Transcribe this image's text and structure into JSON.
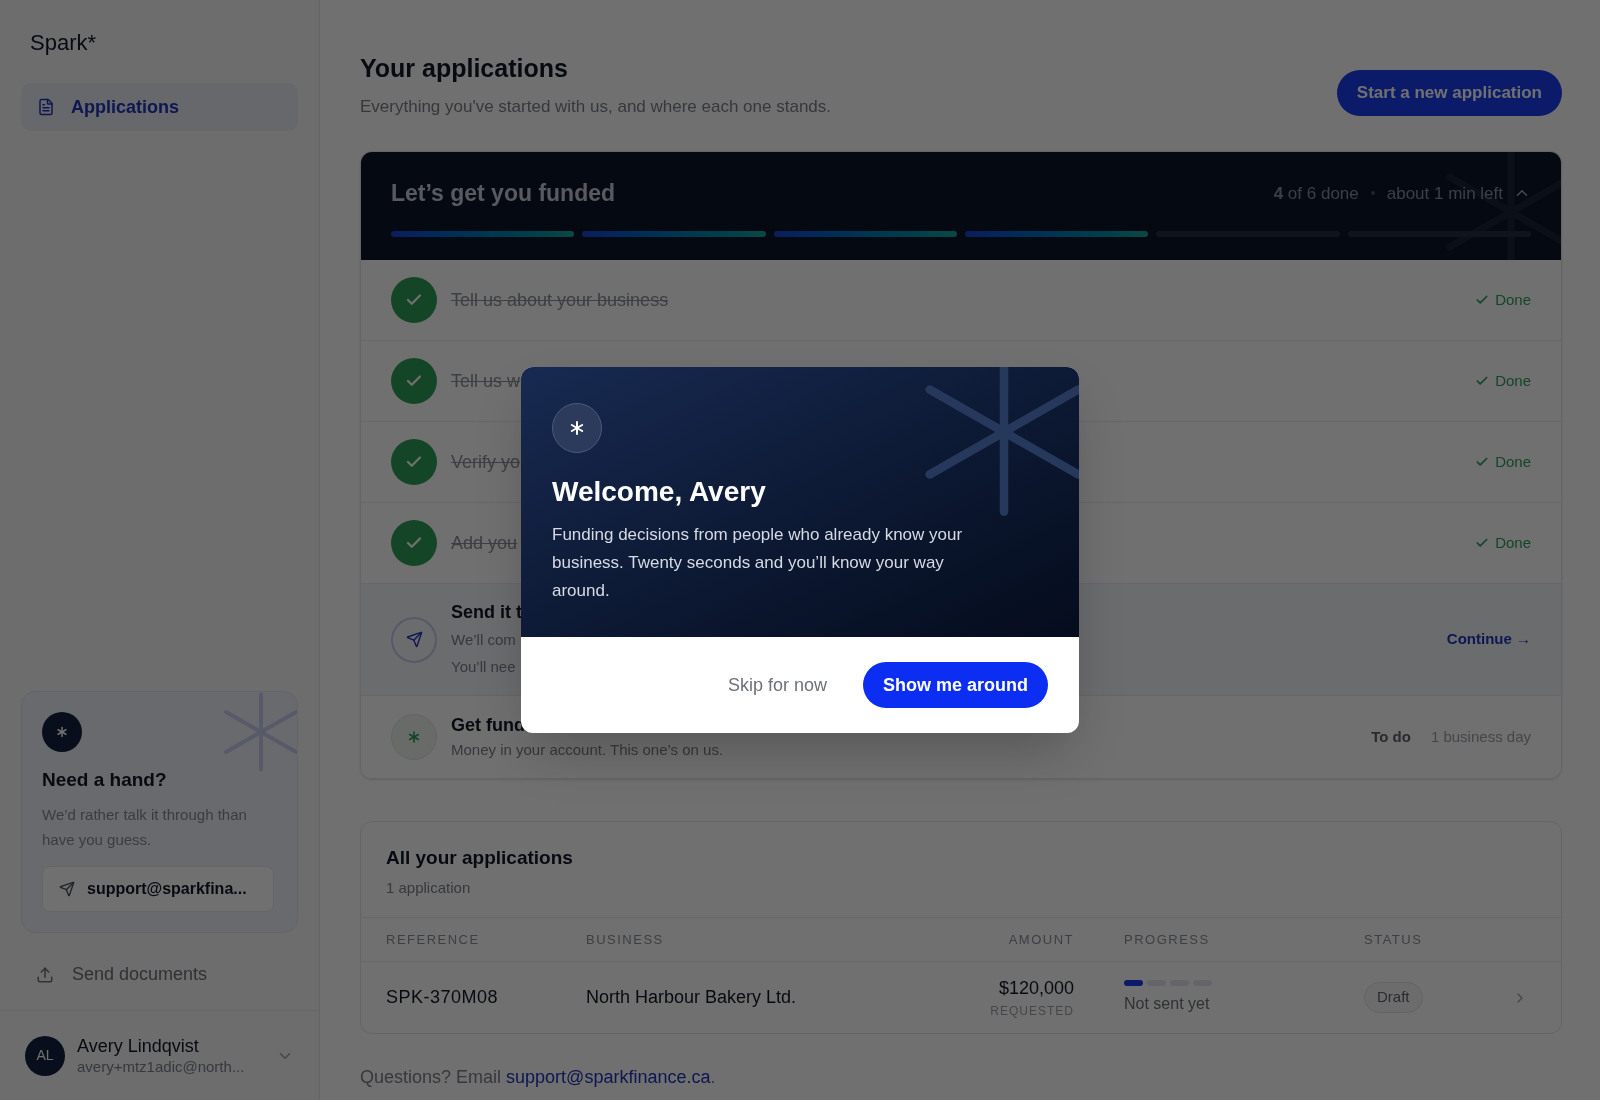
{
  "sidebar": {
    "logo": "Spark*",
    "nav": [
      {
        "label": "Applications",
        "selected": true
      }
    ],
    "help": {
      "title": "Need a hand?",
      "text": "We’d rather talk it through than have you guess.",
      "email_button": "support@sparkfina..."
    },
    "links": [
      {
        "label": "Send documents"
      }
    ],
    "user": {
      "initials": "AL",
      "name": "Avery Lindqvist",
      "email": "avery+mtz1adic@north...",
      "expanded": false
    }
  },
  "header": {
    "title": "Your applications",
    "subtitle": "Everything you've started with us, and where each one stands.",
    "button": "Start a new application"
  },
  "checklist": {
    "title": "Let’s get you funded",
    "count": "**4** of 6 done",
    "eta": "about 1 min left",
    "expanded": true,
    "segments": [
      {
        "done": true
      },
      {
        "done": true
      },
      {
        "done": true
      },
      {
        "done": true
      },
      {
        "done": false
      },
      {
        "done": false
      }
    ],
    "steps": [
      {
        "kind": "done",
        "title": "Tell us about your business",
        "status": "Done"
      },
      {
        "kind": "done",
        "title": "Tell us w",
        "status": "Done"
      },
      {
        "kind": "done",
        "title": "Verify yo",
        "status": "Done"
      },
      {
        "kind": "done",
        "title": "Add you",
        "status": "Done"
      },
      {
        "kind": "current",
        "title": "Send it t",
        "lines": [
          "We’ll com",
          "You’ll nee"
        ],
        "action": "Continue →"
      },
      {
        "kind": "todo",
        "title": "Get fund",
        "description": "Money in your account. This one’s on us.",
        "status": "To do",
        "eta": "1 business day"
      }
    ]
  },
  "applications": {
    "title": "All your applications",
    "count": "1 application",
    "columns": [
      "REFERENCE",
      "BUSINESS",
      "AMOUNT",
      "PROGRESS",
      "STATUS"
    ],
    "rows": [
      {
        "reference": "SPK-370M08",
        "business": "North Harbour Bakery Ltd.",
        "amount": "$120,000",
        "amount_note": "REQUESTED",
        "segments": [
          {
            "done": true
          },
          {
            "done": false
          },
          {
            "done": false
          },
          {
            "done": false
          }
        ],
        "progress_text": "Not sent yet",
        "status": "Draft"
      }
    ]
  },
  "footer": {
    "text": "Questions? Email ",
    "link": "support@sparkfinance.ca",
    "after": "."
  },
  "modal": {
    "title": "Welcome, Avery",
    "body": "Funding decisions from people who already know your business. Twenty seconds and you’ll know your way around.",
    "secondary": "Skip for now",
    "primary": "Show me around"
  }
}
